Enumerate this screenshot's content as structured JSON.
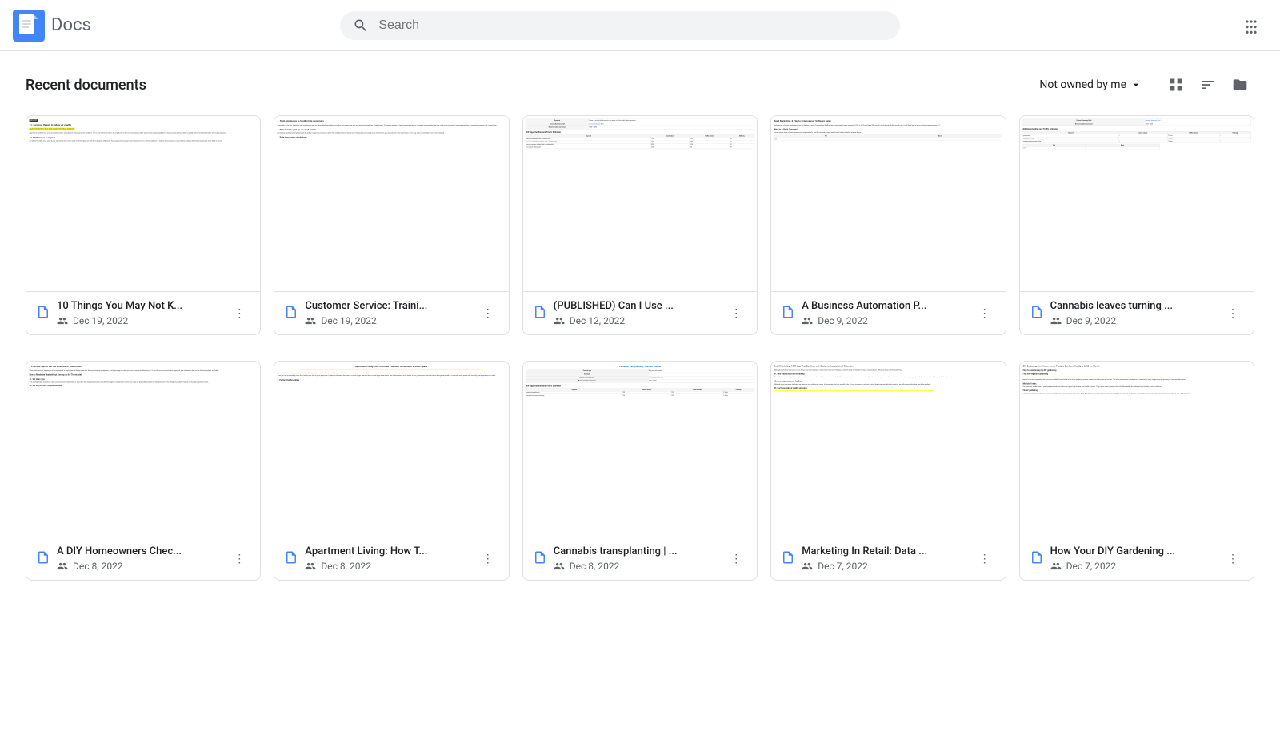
{
  "header": {
    "logo_text": "Docs",
    "search_placeholder": "Search",
    "apps_icon": "⠿"
  },
  "toolbar": {
    "section_title": "Recent documents",
    "filter_label": "Not owned by me",
    "filter_icon": "▾"
  },
  "view_icons": {
    "grid": "▦",
    "sort": "AZ",
    "folder": "📁"
  },
  "documents_row1": [
    {
      "title": "10 Things You May Not K...",
      "date": "Dec 19, 2022",
      "preview_heading": "#1. Common threats to indoor air quality",
      "preview_text": "Apartment dwellers have a lot of potential indoor air pollutants coming from the outdoors. This is due to the fact that a lot of pollution in the air contributes to other areas where many people live in close proximity..."
    },
    {
      "title": "Customer Service: Traini...",
      "date": "Dec 19, 2022",
      "preview_heading": "1. Train employees to handle irate customers",
      "preview_text": "If possible, in the city, questions your employees may not have talked about before and that any experience with you should be treated as a high priority. The reason for this is that if someone is angry, it is easier to something that is a much more important issue because they're expecting to come with a good team. Most likely..."
    },
    {
      "title": "(PUBLISHED) Can I Use ...",
      "date": "Dec 12, 2022",
      "preview_heading": "KW Opportunities and Traffic Estimate",
      "has_table": true
    },
    {
      "title": "A Business Automation P...",
      "date": "Dec 9, 2022",
      "preview_heading": "SaaS Marketing: 6 Tips to Improve your Software Sales",
      "preview_text": "Software as a Service applications are on the way to grow. The solution SaaS market is expected to grow by roughly 20% in 2022 and has a 33% growth rate this year. At this growth rate, it will likely lead to other fast-growing programs in IT..."
    },
    {
      "title": "Cannabis leaves turning ...",
      "date": "Dec 9, 2022",
      "preview_heading": "KW Opportunities and Traffic Estimate",
      "has_table": true
    }
  ],
  "documents_row2": [
    {
      "title": "A DIY Homeowners Chec...",
      "date": "Dec 8, 2022",
      "preview_heading": "7 Practical Tips to Get the Most Out of your Heater",
      "preview_text": "When winter comes, keeping your house warm is a simple item of the top priorities. However, heating is expensive, and depending on where you live, it may be prohibitively so. To find the most cost-effective approach, you will need to look at the different options available to you and take a well-reasoned approach to the process..."
    },
    {
      "title": "Apartment Living: How T...",
      "date": "Dec 8, 2022",
      "preview_heading": "Apartment Living: How to Create a Modern Aesthetic in a Small Space",
      "preview_text": "If you are like the majority of apartment dwellers, you live in a place that doesn't offer you a lot of a few. It is an environment, will often want to create to ensure the room to stay right in the..."
    },
    {
      "title": "Cannabis transplanting | ...",
      "date": "Dec 8, 2022",
      "preview_heading": "Cannabis transplanting | Content Outline",
      "has_table": true
    },
    {
      "title": "Marketing In Retail: Data ...",
      "date": "Dec 7, 2022",
      "preview_heading": "Retail Marketing: 10 Things That Can Help with Customer Acquisition & Retention",
      "preview_text": "Although marketing may have a lot of things you need to keep in mind, there are a lot of things you need to keep in mind for having a retail business. What can help with the marketing..."
    },
    {
      "title": "How Your DIY Gardening ...",
      "date": "Dec 7, 2022",
      "preview_heading": "DIY Gardening: How Home-grown Produce Can Save You Up to $600 per Month",
      "preview_text": "In this tip and idea, this project for us is a through to Low Waste universe we can share our content and to help others achieve a budget-friendly..."
    }
  ]
}
